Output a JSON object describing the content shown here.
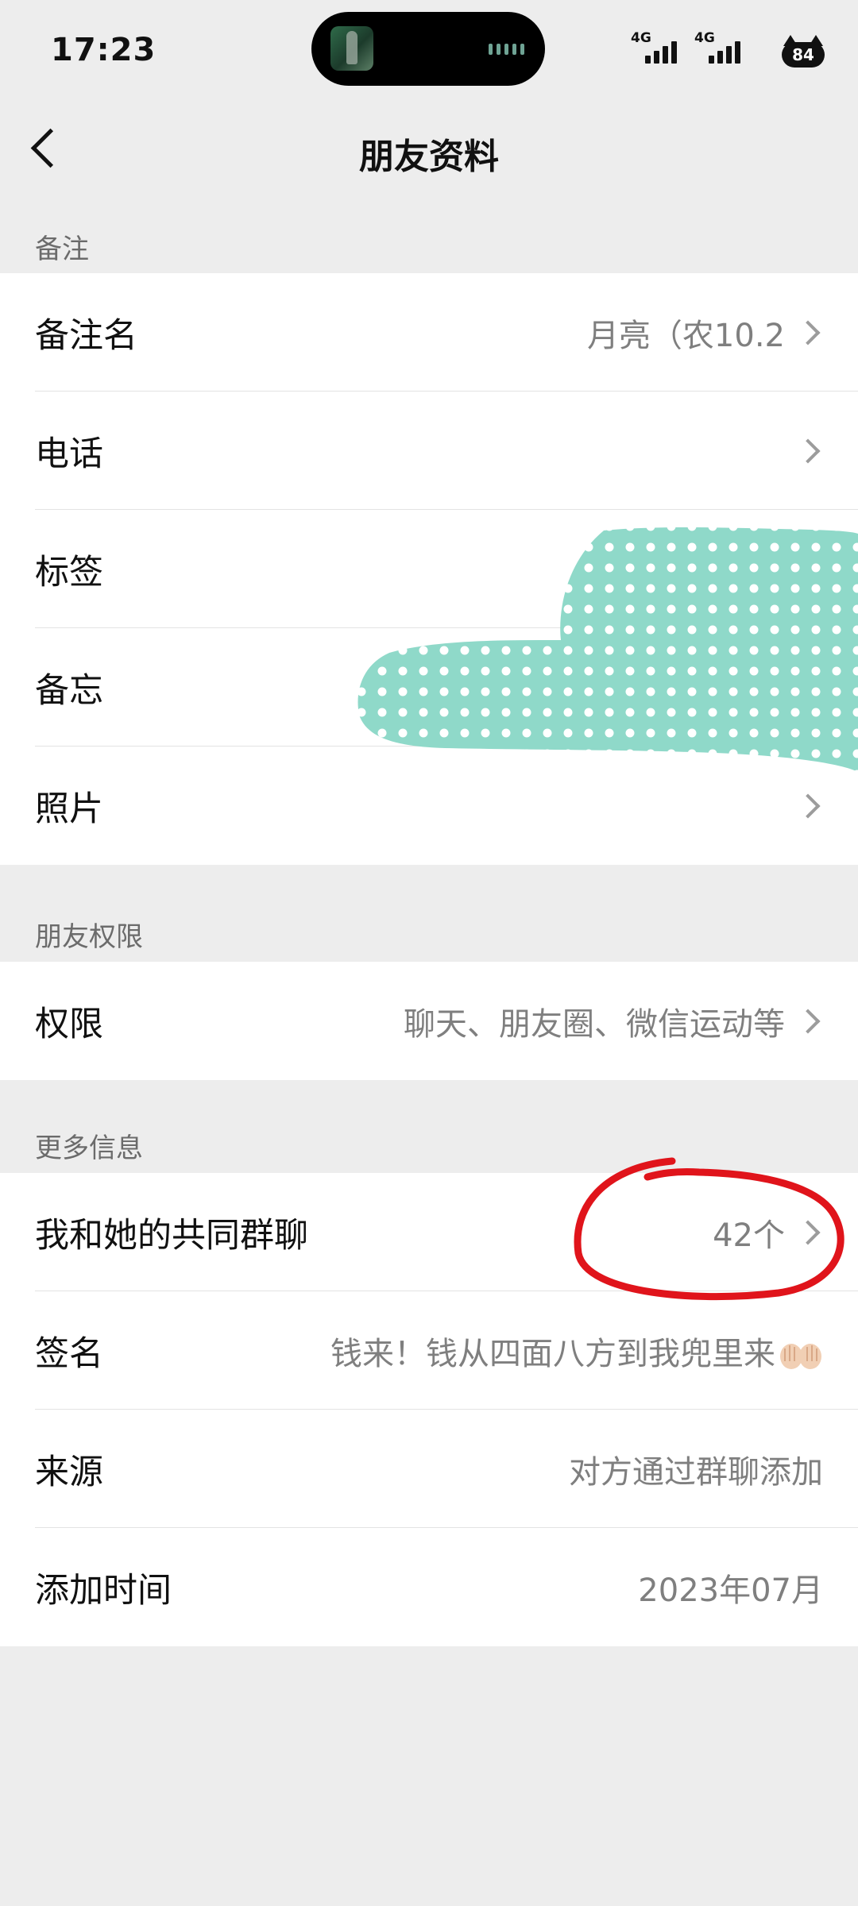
{
  "status_bar": {
    "time": "17:23",
    "signal_1_label": "4G",
    "signal_2_label": "4G",
    "battery_level": "84"
  },
  "nav": {
    "title": "朋友资料"
  },
  "sections": {
    "remark_header": "备注",
    "permission_header": "朋友权限",
    "more_header": "更多信息"
  },
  "remark": {
    "name_label": "备注名",
    "name_value": "月亮（农10.2",
    "phone_label": "电话",
    "tags_label": "标签",
    "memo_label": "备忘",
    "photos_label": "照片"
  },
  "permission": {
    "label": "权限",
    "value": "聊天、朋友圈、微信运动等"
  },
  "more": {
    "groups_label": "我和她的共同群聊",
    "groups_value": "42个",
    "signature_label": "签名",
    "signature_value": "钱来！钱从四面八方到我兜里来",
    "source_label": "来源",
    "source_value": "对方通过群聊添加",
    "added_label": "添加时间",
    "added_value": "2023年07月"
  },
  "colors": {
    "background": "#ededed",
    "redaction": "#8fd9c9",
    "annotation": "#e0141b"
  }
}
